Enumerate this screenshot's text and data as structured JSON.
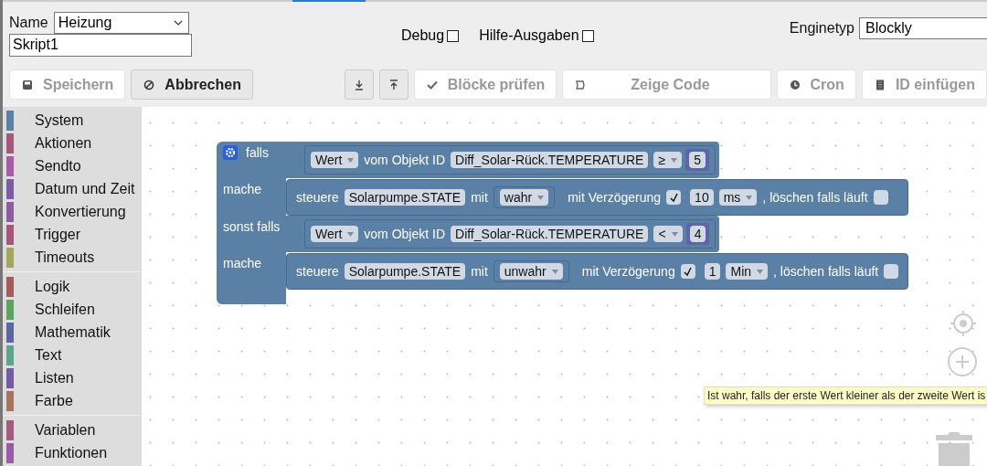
{
  "header": {
    "name_label": "Name",
    "name_select": "Heizung",
    "script_name": "Skript1",
    "options": [
      {
        "label": "Debug",
        "checked": false
      },
      {
        "label": "Hilfe-Ausgaben",
        "checked": false
      }
    ],
    "engine_label": "Enginetyp",
    "engine_select": "Blockly"
  },
  "toolbar": [
    {
      "kind": "text",
      "label": "Speichern",
      "disabled": true
    },
    {
      "kind": "text",
      "label": "Abbrechen",
      "disabled": false
    },
    {
      "kind": "icon",
      "disabled": false
    },
    {
      "kind": "icon",
      "disabled": false
    },
    {
      "kind": "text",
      "label": "Blöcke prüfen",
      "disabled": true
    },
    {
      "kind": "text",
      "label": "Zeige Code",
      "disabled": true
    },
    {
      "kind": "text",
      "label": "Cron",
      "disabled": true
    },
    {
      "kind": "text",
      "label": "ID einfügen",
      "disabled": true
    }
  ],
  "sidebar": {
    "groups": [
      {
        "items": [
          {
            "label": "System",
            "color": "#5b80a5"
          },
          {
            "label": "Aktionen",
            "color": "#a5587a"
          },
          {
            "label": "Sendto",
            "color": "#a55ba5"
          },
          {
            "label": "Datum und Zeit",
            "color": "#7d5ba5"
          },
          {
            "label": "Konvertierung",
            "color": "#8f5ba5"
          },
          {
            "label": "Trigger",
            "color": "#a5587a"
          },
          {
            "label": "Timeouts",
            "color": "#a5a55b"
          }
        ]
      },
      {
        "items": [
          {
            "label": "Logik",
            "color": "#a55b5b"
          },
          {
            "label": "Schleifen",
            "color": "#5ba55b"
          },
          {
            "label": "Mathematik",
            "color": "#5b67a5"
          },
          {
            "label": "Text",
            "color": "#5ba58c"
          },
          {
            "label": "Listen",
            "color": "#745ba5"
          },
          {
            "label": "Farbe",
            "color": "#a5745b"
          }
        ]
      },
      {
        "items": [
          {
            "label": "Variablen",
            "color": "#a55b80"
          },
          {
            "label": "Funktionen",
            "color": "#995ba5"
          }
        ]
      }
    ]
  },
  "if_block": {
    "clauses": [
      {
        "kind": "condition",
        "label": "falls",
        "source": "Wert",
        "text": "vom Objekt ID",
        "object_id": "Diff_Solar-Rück.TEMPERATURE",
        "operator": "≥",
        "value": "5"
      },
      {
        "kind": "action",
        "label": "mache",
        "verb": "steuere",
        "target": "Solarpumpe.STATE",
        "with": "mit",
        "state_value": "wahr",
        "delay_label": "mit Verzögerung",
        "delay": true,
        "delay_value": "10",
        "unit": "ms",
        "clear_label": ", löschen falls läuft",
        "clear": false
      },
      {
        "kind": "condition",
        "label": "sonst falls",
        "source": "Wert",
        "text": "vom Objekt ID",
        "object_id": "Diff_Solar-Rück.TEMPERATURE",
        "operator": "<",
        "value": "4"
      },
      {
        "kind": "action",
        "label": "mache",
        "verb": "steuere",
        "target": "Solarpumpe.STATE",
        "with": "mit",
        "state_value": "unwahr",
        "delay_label": "mit Verzögerung",
        "delay": true,
        "delay_value": "1",
        "unit": "Min",
        "clear_label": ", löschen falls läuft",
        "clear": false
      }
    ]
  },
  "tooltip": "Ist wahr, falls der erste Wert kleiner als der zweite Wert is"
}
